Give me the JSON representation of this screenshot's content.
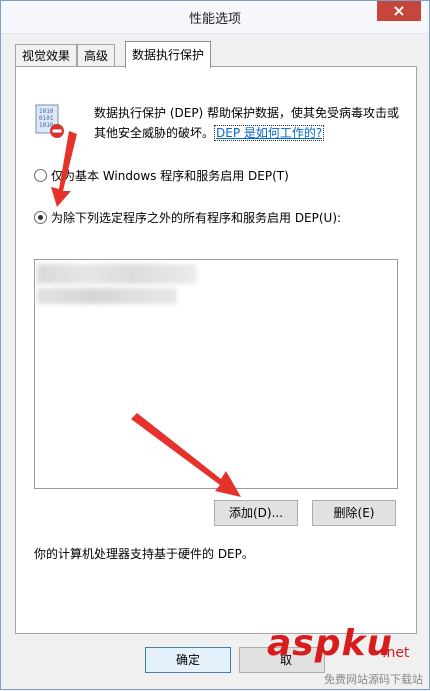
{
  "window": {
    "title": "性能选项",
    "close_glyph": "×"
  },
  "tabs": [
    {
      "label": "视觉效果"
    },
    {
      "label": "高级"
    },
    {
      "label": "数据执行保护"
    }
  ],
  "dep": {
    "description": "数据执行保护 (DEP) 帮助保护数据，使其免受病毒攻击或其他安全威胁的破坏。",
    "link_text": "DEP 是如何工作的?",
    "option_essential": "仅为基本 Windows 程序和服务启用 DEP(T)",
    "option_all_except": "为除下列选定程序之外的所有程序和服务启用 DEP(U):",
    "selected_option": "all_except",
    "add_button": "添加(D)...",
    "remove_button": "删除(E)",
    "support_text": "你的计算机处理器支持基于硬件的 DEP。"
  },
  "footer": {
    "ok_button": "确定",
    "cancel_button_partial": "取"
  },
  "watermark": {
    "logo": "aspku",
    "suffix": ".net",
    "tagline": "免费网站源码下载站"
  },
  "colors": {
    "accent_link": "#0066cc",
    "arrow_red": "#e5322b",
    "close_red": "#c7463b"
  }
}
